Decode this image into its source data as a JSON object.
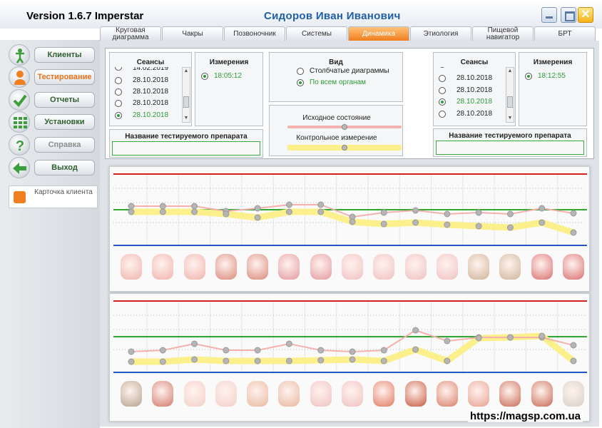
{
  "window": {
    "version": "Version 1.6.7 Imperstar",
    "patient": "Сидоров  Иван  Иванович"
  },
  "tabs": [
    "Круговая диаграмма",
    "Чакры",
    "Позвоночник",
    "Системы",
    "Динамика",
    "Этиология",
    "Пищевой навигатор",
    "БРТ"
  ],
  "active_tab": "Динамика",
  "nav": [
    {
      "label": "Клиенты",
      "icon": "person-icon"
    },
    {
      "label": "Тестирование",
      "icon": "user-icon"
    },
    {
      "label": "Отчеты",
      "icon": "checkmark-icon"
    },
    {
      "label": "Установки",
      "icon": "grid-icon"
    },
    {
      "label": "Справка",
      "icon": "question-icon"
    },
    {
      "label": "Выход",
      "icon": "exit-arrow-icon"
    }
  ],
  "client_card": "Карточка клиента",
  "left": {
    "sessions_title": "Сеансы",
    "sessions": [
      "14.02.2019",
      "28.10.2018",
      "28.10.2018",
      "28.10.2018",
      "28.10.2018"
    ],
    "sessions_selected": 4,
    "measurements_title": "Измерения",
    "measurements": [
      "18:05:12"
    ],
    "drug_label": "Название тестируемого препарата",
    "drug_value": ""
  },
  "view": {
    "title": "Вид",
    "options": [
      "Столбчатые диаграммы",
      "По всем органам"
    ],
    "selected": 1,
    "baseline_label": "Исходное состояние",
    "control_label": "Контрольное измерение"
  },
  "right": {
    "sessions_title": "Сеансы",
    "sessions": [
      "28.10.2018",
      "28.10.2018",
      "28.10.2018",
      "28.10.2018"
    ],
    "sessions_selected": 2,
    "measurements_title": "Измерения",
    "measurements": [
      "18:12:55"
    ],
    "drug_label": "Название тестируемого препарата",
    "drug_value": ""
  },
  "charts": [
    {
      "organs": [
        "brain-icon",
        "brain-icon",
        "brain-icon",
        "eye-icon",
        "eye-icon",
        "mouth-icon",
        "mouth-icon",
        "lung-icon",
        "lung-icon",
        "lung-icon",
        "lung-icon",
        "nerve-icon",
        "nerve-icon",
        "vessel-icon",
        "vessel-icon"
      ],
      "initial": [
        0.55,
        0.55,
        0.55,
        0.48,
        0.52,
        0.57,
        0.57,
        0.4,
        0.46,
        0.49,
        0.44,
        0.46,
        0.44,
        0.52,
        0.45
      ],
      "control": [
        0.47,
        0.47,
        0.47,
        0.44,
        0.39,
        0.47,
        0.47,
        0.33,
        0.3,
        0.32,
        0.29,
        0.27,
        0.25,
        0.32,
        0.18
      ]
    },
    {
      "organs": [
        "spine-icon",
        "throat-icon",
        "thyroid-icon",
        "thyroid-icon",
        "bronchi-icon",
        "bronchi-icon",
        "lung-icon",
        "lung-icon",
        "stomach-icon",
        "liver-icon",
        "intestine-icon",
        "bladder-icon",
        "kidney-icon",
        "kidney-icon",
        "knee-icon"
      ],
      "initial": [
        0.29,
        0.31,
        0.4,
        0.31,
        0.31,
        0.4,
        0.31,
        0.29,
        0.31,
        0.59,
        0.44,
        0.49,
        0.49,
        0.49,
        0.38
      ],
      "control": [
        0.15,
        0.15,
        0.18,
        0.16,
        0.16,
        0.16,
        0.17,
        0.18,
        0.16,
        0.32,
        0.16,
        0.48,
        0.49,
        0.51,
        0.16
      ]
    }
  ],
  "watermark": "https://magsp.com.ua"
}
